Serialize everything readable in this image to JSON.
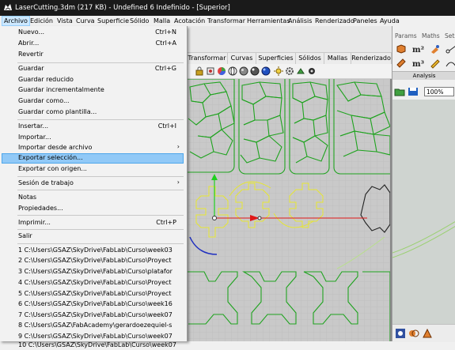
{
  "window": {
    "title": "LaserCutting.3dm (217 KB) - Undefined 6 Indefinido - [Superior]"
  },
  "menubar": [
    {
      "label": "Archivo"
    },
    {
      "label": "Edición"
    },
    {
      "label": "Vista"
    },
    {
      "label": "Curva"
    },
    {
      "label": "Superficie"
    },
    {
      "label": "Sólido"
    },
    {
      "label": "Malla"
    },
    {
      "label": "Acotación"
    },
    {
      "label": "Transformar"
    },
    {
      "label": "Herramientas"
    },
    {
      "label": "Análisis"
    },
    {
      "label": "Renderizado"
    },
    {
      "label": "Paneles"
    },
    {
      "label": "Ayuda"
    }
  ],
  "file_menu": {
    "items": [
      {
        "label": "Nuevo...",
        "shortcut": "Ctrl+N"
      },
      {
        "label": "Abrir...",
        "shortcut": "Ctrl+A"
      },
      {
        "label": "Revertir",
        "shortcut": ""
      },
      {
        "label": "Guardar",
        "shortcut": "Ctrl+G"
      },
      {
        "label": "Guardar reducido",
        "shortcut": ""
      },
      {
        "label": "Guardar incrementalmente",
        "shortcut": ""
      },
      {
        "label": "Guardar como...",
        "shortcut": ""
      },
      {
        "label": "Guardar como plantilla...",
        "shortcut": ""
      },
      {
        "label": "Insertar...",
        "shortcut": "Ctrl+I"
      },
      {
        "label": "Importar...",
        "shortcut": ""
      },
      {
        "label": "Importar desde archivo",
        "shortcut": ""
      },
      {
        "label": "Exportar selección...",
        "shortcut": ""
      },
      {
        "label": "Exportar con origen...",
        "shortcut": ""
      },
      {
        "label": "Sesión de trabajo",
        "shortcut": ""
      },
      {
        "label": "Notas",
        "shortcut": ""
      },
      {
        "label": "Propiedades...",
        "shortcut": ""
      },
      {
        "label": "Imprimir...",
        "shortcut": "Ctrl+P"
      },
      {
        "label": "Salir",
        "shortcut": ""
      },
      {
        "label": "1 C:\\Users\\GSAZ\\SkyDrive\\FabLab\\Curso\\week03",
        "shortcut": ""
      },
      {
        "label": "2 C:\\Users\\GSAZ\\SkyDrive\\FabLab\\Curso\\Proyect",
        "shortcut": ""
      },
      {
        "label": "3 C:\\Users\\GSAZ\\SkyDrive\\FabLab\\Curso\\platafor",
        "shortcut": ""
      },
      {
        "label": "4 C:\\Users\\GSAZ\\SkyDrive\\FabLab\\Curso\\Proyect",
        "shortcut": ""
      },
      {
        "label": "5 C:\\Users\\GSAZ\\SkyDrive\\FabLab\\Curso\\Proyect",
        "shortcut": ""
      },
      {
        "label": "6 C:\\Users\\GSAZ\\SkyDrive\\FabLab\\Curso\\week16",
        "shortcut": ""
      },
      {
        "label": "7 C:\\Users\\GSAZ\\SkyDrive\\FabLab\\Curso\\week07",
        "shortcut": ""
      },
      {
        "label": "8 C:\\Users\\GSAZ\\FabAcademy\\gerardoezequiel-s",
        "shortcut": ""
      },
      {
        "label": "9 C:\\Users\\GSAZ\\SkyDrive\\FabLab\\Curso\\week07",
        "shortcut": ""
      },
      {
        "label": "10 C:\\Users\\GSAZ\\SkyDrive\\FabLab\\Curso\\week07",
        "shortcut": ""
      }
    ],
    "highlighted_item": "Exportar selección..."
  },
  "tabs": [
    {
      "label": "Transformar"
    },
    {
      "label": "Curvas"
    },
    {
      "label": "Superficies"
    },
    {
      "label": "Sólidos"
    },
    {
      "label": "Mallas"
    },
    {
      "label": "Renderizado"
    }
  ],
  "right_panel": {
    "tabs": [
      {
        "label": "Params"
      },
      {
        "label": "Maths"
      },
      {
        "label": "Sets"
      }
    ],
    "group_label": "Analysis",
    "zoom_value": "100%"
  },
  "colors": {
    "titlebar": "#1a1a1a",
    "menu_highlight": "#91c9f7",
    "curve_green": "#1fa31f",
    "curve_yellow": "#e6e632",
    "axis_red": "#e01818",
    "viewport_bg": "#c9c9c9"
  }
}
